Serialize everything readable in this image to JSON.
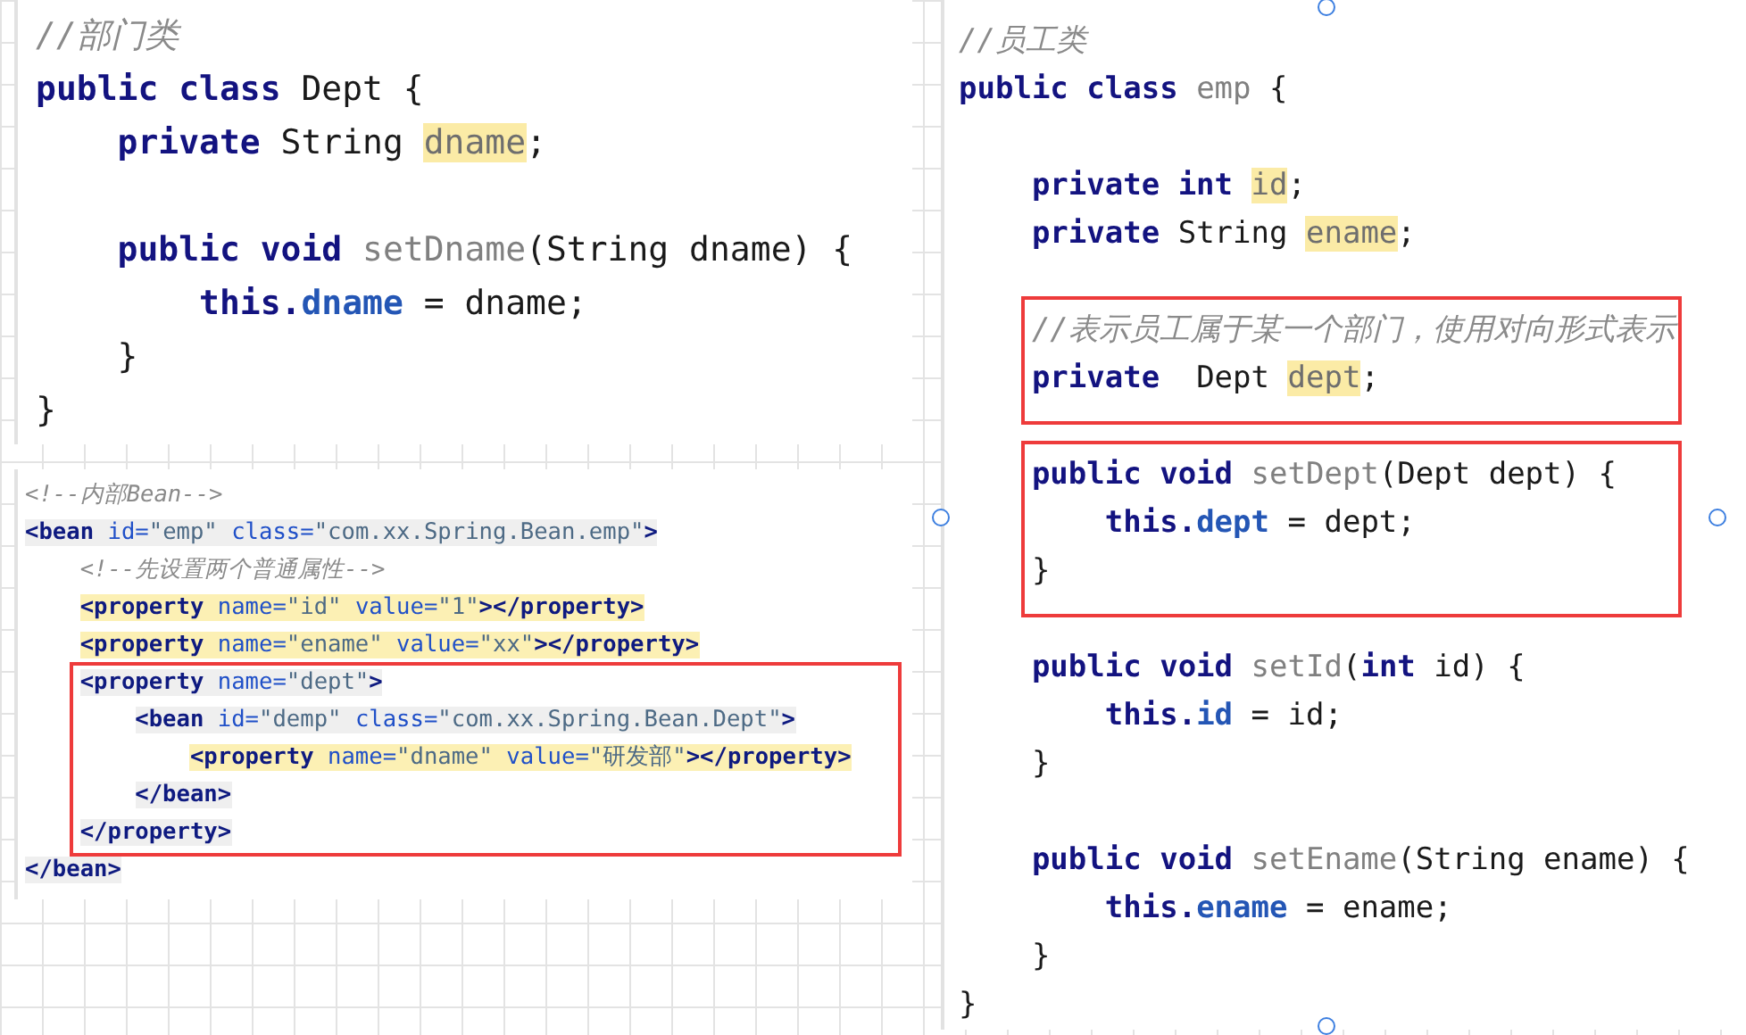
{
  "editors": [
    {
      "kind": "java",
      "blocks": [
        {
          "boxed": false,
          "lines": [
            {
              "tokens": [
                {
                  "text": "//部门类",
                  "kind": "comment"
                }
              ]
            },
            {
              "tokens": [
                {
                  "text": "public class ",
                  "kind": "keyword"
                },
                {
                  "text": "Dept {",
                  "kind": "plain"
                }
              ]
            },
            {
              "tokens": [
                {
                  "text": "    private ",
                  "kind": "keyword"
                },
                {
                  "text": "String ",
                  "kind": "plain"
                },
                {
                  "text": "dname",
                  "kind": "field-mark"
                },
                {
                  "text": ";",
                  "kind": "plain"
                }
              ]
            }
          ]
        },
        {
          "boxed": false,
          "lines": [
            {
              "tokens": [
                {
                  "text": "    public void ",
                  "kind": "keyword"
                },
                {
                  "text": "setDname",
                  "kind": "unused"
                },
                {
                  "text": "(String dname) {",
                  "kind": "plain"
                }
              ]
            },
            {
              "tokens": [
                {
                  "text": "        this.",
                  "kind": "keyword"
                },
                {
                  "text": "dname",
                  "kind": "member"
                },
                {
                  "text": " = dname;",
                  "kind": "plain"
                }
              ]
            },
            {
              "tokens": [
                {
                  "text": "    }",
                  "kind": "plain"
                }
              ]
            },
            {
              "tokens": [
                {
                  "text": "}",
                  "kind": "plain"
                }
              ]
            }
          ]
        }
      ]
    },
    {
      "kind": "xml",
      "blocks": [
        {
          "boxed": false,
          "lines": [
            {
              "kind": "plain",
              "tokens": [
                {
                  "text": "<!--内部Bean-->",
                  "kind": "comment"
                }
              ]
            },
            {
              "kind": "element",
              "tokens": [
                {
                  "text": "<bean ",
                  "kind": "tag"
                },
                {
                  "text": "id=",
                  "kind": "attr"
                },
                {
                  "text": "\"emp\" ",
                  "kind": "value"
                },
                {
                  "text": "class=",
                  "kind": "attr"
                },
                {
                  "text": "\"com.xx.Spring.Bean.emp\"",
                  "kind": "value"
                },
                {
                  "text": ">",
                  "kind": "tag"
                }
              ]
            },
            {
              "kind": "plain",
              "tokens": [
                {
                  "text": "    <!--先设置两个普通属性-->",
                  "kind": "comment"
                }
              ]
            },
            {
              "kind": "usage",
              "tokens": [
                {
                  "text": "    <property ",
                  "kind": "tag"
                },
                {
                  "text": "name=",
                  "kind": "attr"
                },
                {
                  "text": "\"id\" ",
                  "kind": "value"
                },
                {
                  "text": "value=",
                  "kind": "attr"
                },
                {
                  "text": "\"1\"",
                  "kind": "value"
                },
                {
                  "text": "></property>",
                  "kind": "tag"
                }
              ]
            },
            {
              "kind": "usage",
              "tokens": [
                {
                  "text": "    <property ",
                  "kind": "tag"
                },
                {
                  "text": "name=",
                  "kind": "attr"
                },
                {
                  "text": "\"ename\" ",
                  "kind": "value"
                },
                {
                  "text": "value=",
                  "kind": "attr"
                },
                {
                  "text": "\"xx\"",
                  "kind": "value"
                },
                {
                  "text": "></property>",
                  "kind": "tag"
                }
              ]
            }
          ]
        },
        {
          "boxed": true,
          "lines": [
            {
              "kind": "element",
              "tokens": [
                {
                  "text": "    <property ",
                  "kind": "tag"
                },
                {
                  "text": "name=",
                  "kind": "attr"
                },
                {
                  "text": "\"dept\"",
                  "kind": "value"
                },
                {
                  "text": ">",
                  "kind": "tag"
                }
              ]
            },
            {
              "kind": "element",
              "tokens": [
                {
                  "text": "        <bean ",
                  "kind": "tag"
                },
                {
                  "text": "id=",
                  "kind": "attr"
                },
                {
                  "text": "\"demp\" ",
                  "kind": "value"
                },
                {
                  "text": "class=",
                  "kind": "attr"
                },
                {
                  "text": "\"com.xx.Spring.Bean.Dept\"",
                  "kind": "value"
                },
                {
                  "text": ">",
                  "kind": "tag"
                }
              ]
            },
            {
              "kind": "usage",
              "tokens": [
                {
                  "text": "            <property ",
                  "kind": "tag"
                },
                {
                  "text": "name=",
                  "kind": "attr"
                },
                {
                  "text": "\"dname\" ",
                  "kind": "value"
                },
                {
                  "text": "value=",
                  "kind": "attr"
                },
                {
                  "text": "\"研发部\"",
                  "kind": "value"
                },
                {
                  "text": "></property>",
                  "kind": "tag"
                }
              ]
            },
            {
              "kind": "element",
              "tokens": [
                {
                  "text": "        </bean>",
                  "kind": "tag"
                }
              ]
            },
            {
              "kind": "element",
              "tokens": [
                {
                  "text": "    </property>",
                  "kind": "tag"
                }
              ]
            }
          ]
        },
        {
          "boxed": false,
          "lines": [
            {
              "kind": "element",
              "tokens": [
                {
                  "text": "</bean>",
                  "kind": "tag"
                }
              ]
            }
          ]
        }
      ]
    },
    {
      "kind": "java",
      "blocks": [
        {
          "boxed": false,
          "lines": [
            {
              "tokens": [
                {
                  "text": "//员工类",
                  "kind": "comment"
                }
              ]
            },
            {
              "tokens": [
                {
                  "text": "public class ",
                  "kind": "keyword"
                },
                {
                  "text": "emp",
                  "kind": "unused"
                },
                {
                  "text": " {",
                  "kind": "plain"
                }
              ]
            }
          ]
        },
        {
          "boxed": false,
          "lines": [
            {
              "tokens": [
                {
                  "text": "    private int ",
                  "kind": "keyword"
                },
                {
                  "text": "id",
                  "kind": "field-mark"
                },
                {
                  "text": ";",
                  "kind": "plain"
                }
              ]
            },
            {
              "tokens": [
                {
                  "text": "    private ",
                  "kind": "keyword"
                },
                {
                  "text": "String ",
                  "kind": "plain"
                },
                {
                  "text": "ename",
                  "kind": "field-mark"
                },
                {
                  "text": ";",
                  "kind": "plain"
                }
              ]
            }
          ]
        },
        {
          "boxed": true,
          "lines": [
            {
              "tokens": [
                {
                  "text": "    //表示员工属于某一个部门，使用对向形式表示",
                  "kind": "comment"
                }
              ]
            },
            {
              "tokens": [
                {
                  "text": "    private ",
                  "kind": "keyword"
                },
                {
                  "text": " Dept ",
                  "kind": "plain"
                },
                {
                  "text": "dept",
                  "kind": "field-mark"
                },
                {
                  "text": ";",
                  "kind": "plain"
                }
              ]
            }
          ]
        },
        {
          "boxed": true,
          "lines": [
            {
              "tokens": [
                {
                  "text": "    public void ",
                  "kind": "keyword"
                },
                {
                  "text": "setDept",
                  "kind": "unused"
                },
                {
                  "text": "(Dept dept) {",
                  "kind": "plain"
                }
              ]
            },
            {
              "tokens": [
                {
                  "text": "        this.",
                  "kind": "keyword"
                },
                {
                  "text": "dept",
                  "kind": "member"
                },
                {
                  "text": " = dept;",
                  "kind": "plain"
                }
              ]
            },
            {
              "tokens": [
                {
                  "text": "    }",
                  "kind": "plain"
                }
              ]
            }
          ]
        },
        {
          "boxed": false,
          "lines": [
            {
              "tokens": [
                {
                  "text": "    public void ",
                  "kind": "keyword"
                },
                {
                  "text": "setId",
                  "kind": "unused"
                },
                {
                  "text": "(",
                  "kind": "plain"
                },
                {
                  "text": "int ",
                  "kind": "keyword"
                },
                {
                  "text": "id) {",
                  "kind": "plain"
                }
              ]
            },
            {
              "tokens": [
                {
                  "text": "        this.",
                  "kind": "keyword"
                },
                {
                  "text": "id",
                  "kind": "member"
                },
                {
                  "text": " = id;",
                  "kind": "plain"
                }
              ]
            },
            {
              "tokens": [
                {
                  "text": "    }",
                  "kind": "plain"
                }
              ]
            }
          ]
        },
        {
          "boxed": false,
          "lines": [
            {
              "tokens": [
                {
                  "text": "    public void ",
                  "kind": "keyword"
                },
                {
                  "text": "setEname",
                  "kind": "unused"
                },
                {
                  "text": "(String ename) {",
                  "kind": "plain"
                }
              ]
            },
            {
              "tokens": [
                {
                  "text": "        this.",
                  "kind": "keyword"
                },
                {
                  "text": "ename",
                  "kind": "member"
                },
                {
                  "text": " = ename;",
                  "kind": "plain"
                }
              ]
            },
            {
              "tokens": [
                {
                  "text": "    }",
                  "kind": "plain"
                }
              ]
            },
            {
              "tokens": [
                {
                  "text": "}",
                  "kind": "plain"
                }
              ]
            }
          ]
        }
      ]
    }
  ]
}
